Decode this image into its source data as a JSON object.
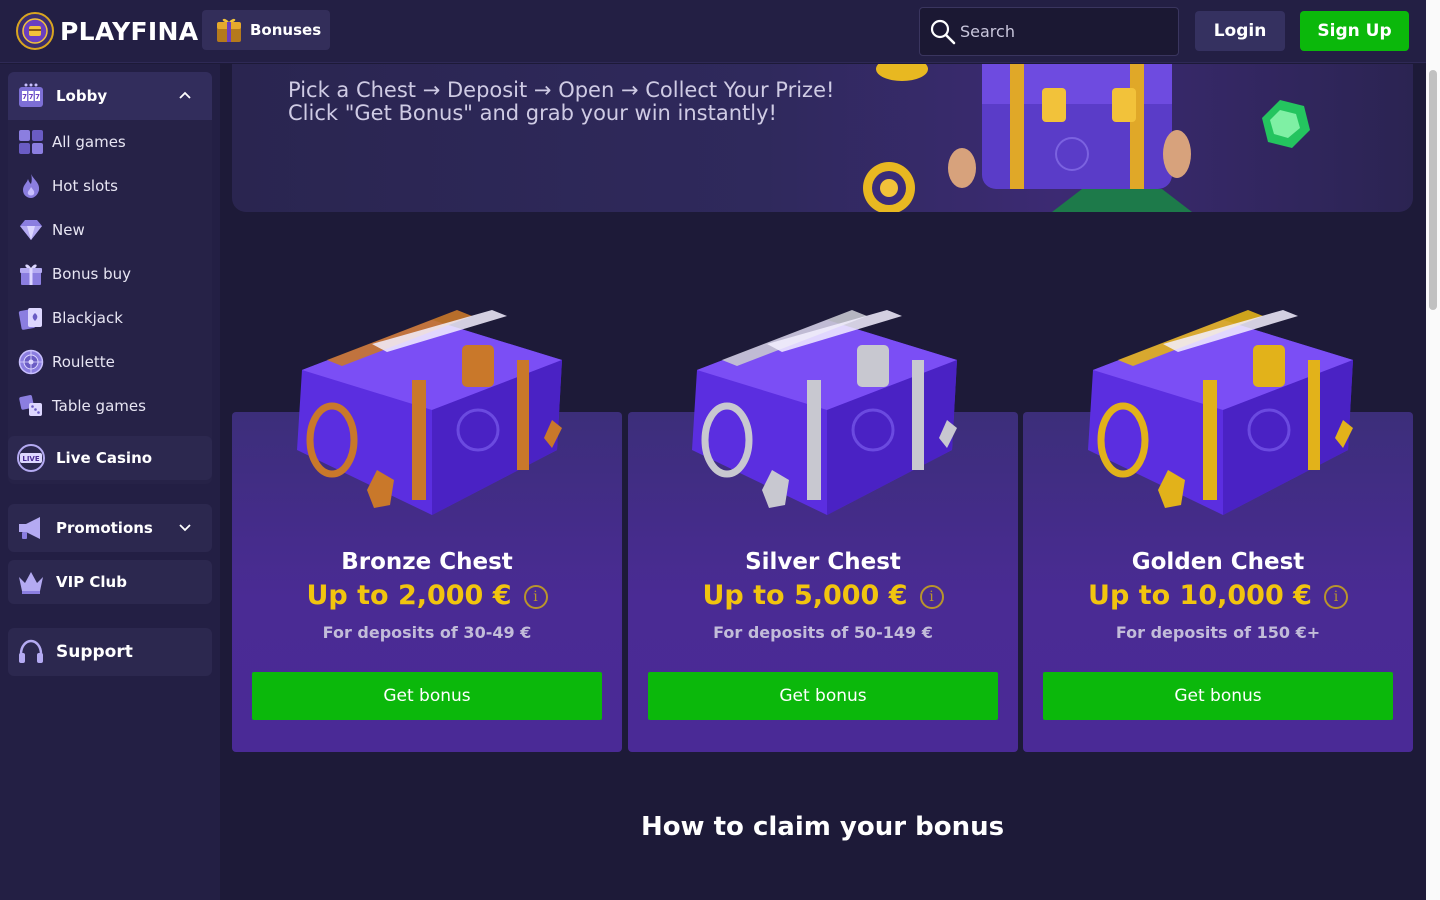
{
  "brand": {
    "name": "PLAYFINA"
  },
  "header": {
    "bonuses_label": "Bonuses",
    "search_placeholder": "Search",
    "login_label": "Login",
    "signup_label": "Sign Up"
  },
  "sidebar": {
    "lobby": {
      "label": "Lobby",
      "expanded": true,
      "items": [
        {
          "label": "All games",
          "icon": "grid-icon"
        },
        {
          "label": "Hot slots",
          "icon": "flame-icon"
        },
        {
          "label": "New",
          "icon": "diamond-icon"
        },
        {
          "label": "Bonus buy",
          "icon": "gift-icon"
        },
        {
          "label": "Blackjack",
          "icon": "cards-icon"
        },
        {
          "label": "Roulette",
          "icon": "roulette-icon"
        },
        {
          "label": "Table games",
          "icon": "dice-icon"
        }
      ]
    },
    "live_casino": {
      "label": "Live Casino",
      "icon_text": "LIVE"
    },
    "promotions": {
      "label": "Promotions",
      "expanded": false
    },
    "vip": {
      "label": "VIP Club"
    },
    "support": {
      "label": "Support"
    }
  },
  "hero": {
    "line1": "Pick a Chest → Deposit → Open → Collect Your Prize!",
    "line2": "Click \"Get Bonus\" and grab your win instantly!"
  },
  "chests": [
    {
      "title": "Bronze Chest",
      "amount": "Up to 2,000 €",
      "desc": "For deposits of 30-49 €",
      "button": "Get bonus",
      "metal": "#c9782a"
    },
    {
      "title": "Silver Chest",
      "amount": "Up to 5,000 €",
      "desc": "For deposits of 50-149 €",
      "button": "Get bonus",
      "metal": "#c8c8d0"
    },
    {
      "title": "Golden Chest",
      "amount": "Up to 10,000 €",
      "desc": "For deposits of 150 €+",
      "button": "Get bonus",
      "metal": "#e2b21a"
    }
  ],
  "how_title": "How to claim your bonus",
  "colors": {
    "accent_green": "#0bb80b",
    "amount_gold": "#f1c40f",
    "background": "#1d1a38",
    "card_purple": "#4a2b94"
  }
}
